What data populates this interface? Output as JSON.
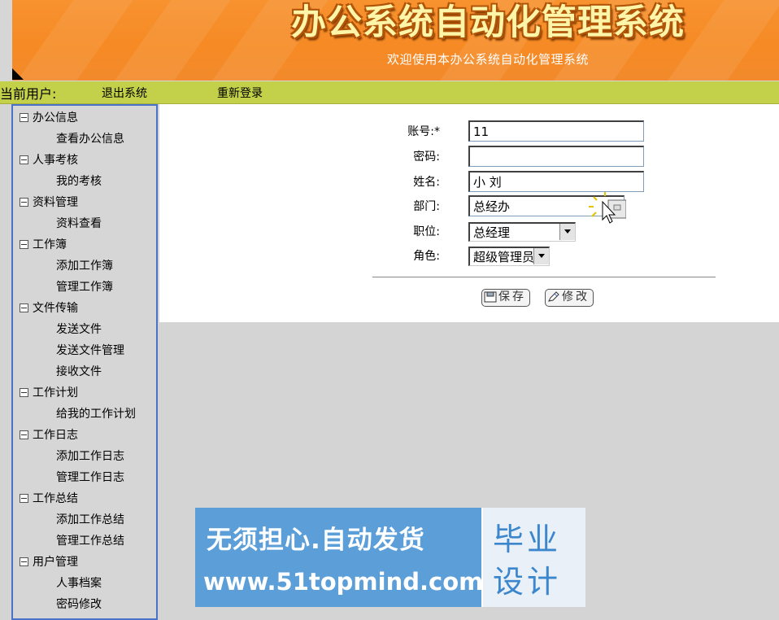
{
  "header": {
    "title": "办公系统自动化管理系统",
    "subtitle": "欢迎使用本办公系统自动化管理系统"
  },
  "userbar": {
    "current_user_label": "当前用户:",
    "logout": "退出系统",
    "relogin": "重新登录"
  },
  "sidebar": {
    "groups": [
      {
        "label": "办公信息",
        "items": [
          "查看办公信息"
        ]
      },
      {
        "label": "人事考核",
        "items": [
          "我的考核"
        ]
      },
      {
        "label": "资料管理",
        "items": [
          "资料查看"
        ]
      },
      {
        "label": "工作簿",
        "items": [
          "添加工作簿",
          "管理工作簿"
        ]
      },
      {
        "label": "文件传输",
        "items": [
          "发送文件",
          "发送文件管理",
          "接收文件"
        ]
      },
      {
        "label": "工作计划",
        "items": [
          "给我的工作计划"
        ]
      },
      {
        "label": "工作日志",
        "items": [
          "添加工作日志",
          "管理工作日志"
        ]
      },
      {
        "label": "工作总结",
        "items": [
          "添加工作总结",
          "管理工作总结"
        ]
      },
      {
        "label": "用户管理",
        "items": [
          "人事档案",
          "密码修改"
        ]
      }
    ]
  },
  "form": {
    "account_label": "账号:*",
    "account_value": "11",
    "password_label": "密码:",
    "password_value": "",
    "name_label": "姓名:",
    "name_value": "小 刘",
    "department_label": "部门:",
    "department_value": "总经办",
    "position_label": "职位:",
    "position_value": "总经理",
    "role_label": "角色:",
    "role_value": "超级管理员",
    "save_label": "保存",
    "modify_label": "修改"
  },
  "ad": {
    "slogan": "无须担心.自动发货",
    "url": "www.51topmind.com",
    "badge_line1": "毕业",
    "badge_line2": "设计"
  }
}
